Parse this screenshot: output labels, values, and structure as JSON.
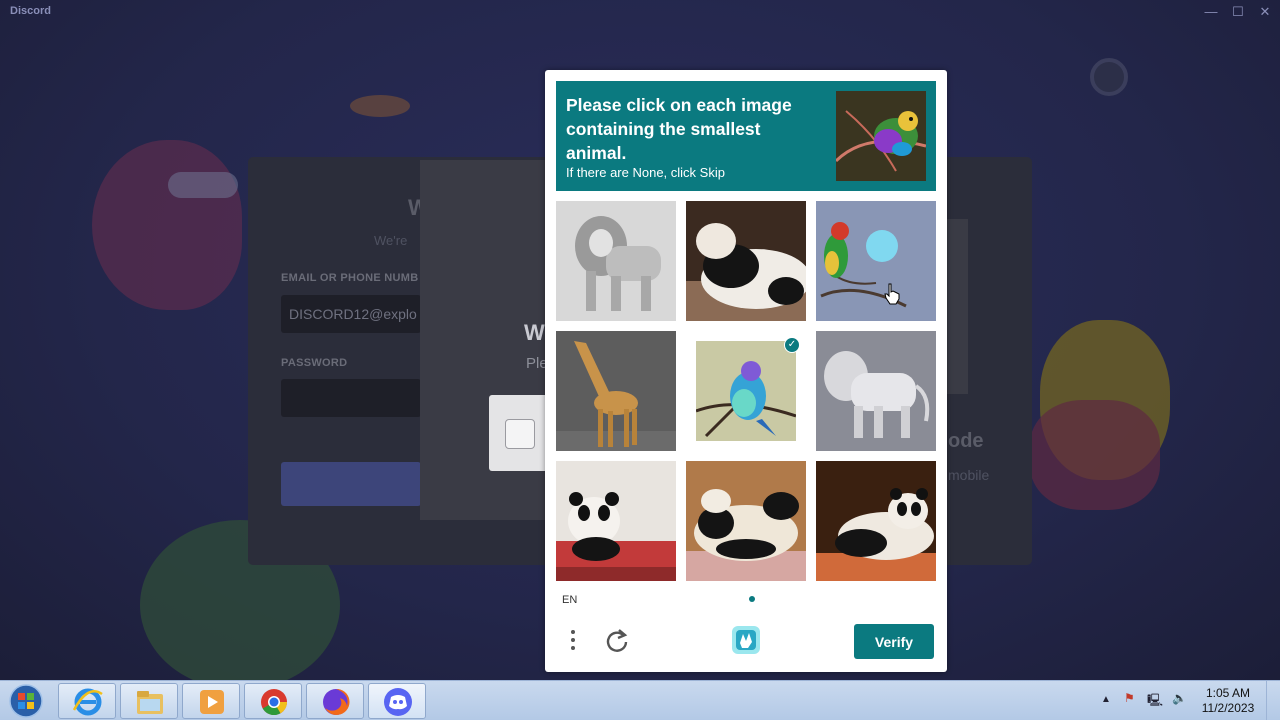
{
  "window": {
    "app_title": "Discord",
    "controls": {
      "minimize": "—",
      "maximize": "☐",
      "close": "✕"
    }
  },
  "login": {
    "email_label": "EMAIL OR PHONE NUMB",
    "email_value": "DISCORD12@explo",
    "password_label": "PASSWORD",
    "heading_fragment": "W",
    "subheading_fragment": "We're",
    "qr_title_fragment": "ode",
    "qr_sub_fragment": "mobile"
  },
  "check_dialog": {
    "title_fragment": "W",
    "text_fragment": "Ple"
  },
  "captcha": {
    "prompt_main": "Please click on each image containing the smallest animal.",
    "prompt_sub": "If there are None, click Skip",
    "prompt_image": "bird-icon",
    "tiles": [
      {
        "subject": "lion",
        "selected": false
      },
      {
        "subject": "panda",
        "selected": false
      },
      {
        "subject": "bird",
        "selected": false
      },
      {
        "subject": "giraffe",
        "selected": false
      },
      {
        "subject": "bird",
        "selected": true
      },
      {
        "subject": "lion",
        "selected": false
      },
      {
        "subject": "panda",
        "selected": false
      },
      {
        "subject": "panda",
        "selected": false
      },
      {
        "subject": "panda",
        "selected": false
      }
    ],
    "language": "EN",
    "menu_icon": "more-vertical-icon",
    "refresh_icon": "refresh-icon",
    "logo_icon": "hcaptcha-logo",
    "verify_label": "Verify",
    "accent_color": "#0b7a80"
  },
  "taskbar": {
    "pinned": [
      "internet-explorer-icon",
      "file-explorer-icon",
      "media-player-icon",
      "chrome-icon",
      "firefox-icon",
      "discord-icon"
    ],
    "tray": {
      "show_hidden": "▲",
      "flag": "⚑",
      "network": "🖳",
      "volume": "🔈"
    },
    "clock_time": "1:05 AM",
    "clock_date": "11/2/2023"
  }
}
